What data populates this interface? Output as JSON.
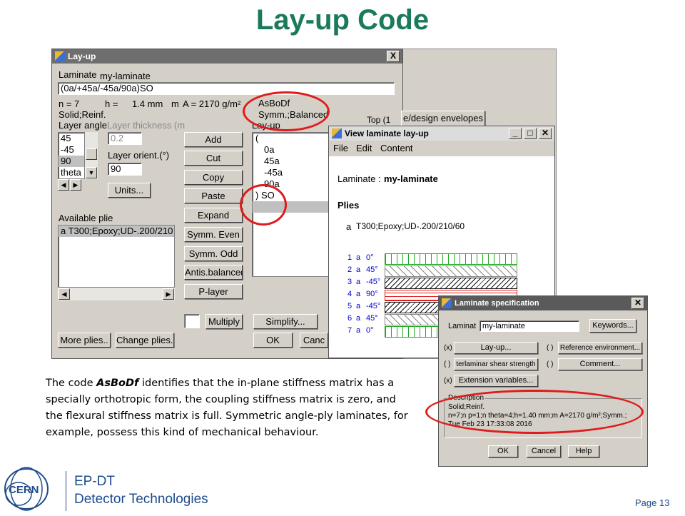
{
  "slide": {
    "title": "Lay-up Code",
    "description_parts": [
      "The code ",
      "AsBoDf",
      " identifies that the in-plane stiffness matrix has a specially orthotropic form, the coupling stiffness matrix is zero, and the flexural stiffness matrix is full. Symmetric angle-ply laminates, for example, possess this kind of mechanical behaviour."
    ],
    "page_number": "Page 13",
    "logo_text": "CERN",
    "org_line1": "EP-DT",
    "org_line2": "Detector Technologies"
  },
  "layup_window": {
    "title": "Lay-up",
    "close": "X",
    "laminate_label": "Laminate",
    "laminate_name": "my-laminate",
    "code_value": "(0a/+45a/-45a/90a)SO",
    "n_text": "n = 7",
    "h_text": "h =",
    "h_value": "1.4 mm",
    "m_text": "m",
    "a_text": "A = 2170 g/m²",
    "solid_text": "Solid;Reinf.",
    "asbodf": "AsBoDf",
    "symm_balanced": "Symm.;Balanced",
    "layer_angle_label": "Layer angle",
    "layer_thickness_label": "Layer thickness (m",
    "angle_list": [
      "45",
      "-45",
      "90",
      "theta"
    ],
    "thickness_value": "0.2",
    "layer_orient_label": "Layer orient.(°)",
    "orient_value": "90",
    "units_button": "Units...",
    "available_plies_label": "Available plie",
    "available_plies": [
      "a T300;Epoxy;UD-.200/210"
    ],
    "layup_list_label": "Lay-up",
    "layup_list": [
      "(",
      "0a",
      "45a",
      "-45a",
      "90a",
      ") SO"
    ],
    "buttons": {
      "add": "Add",
      "cut": "Cut",
      "copy": "Copy",
      "paste": "Paste",
      "expand": "Expand",
      "symm_even": "Symm. Even",
      "symm_odd": "Symm. Odd",
      "antis_balanced": "Antis.balanced",
      "p_layer": "P-layer",
      "multiply": "Multiply",
      "simplify": "Simplify...",
      "ok": "OK",
      "cancel": "Canc",
      "more_plies": "More plies..",
      "change_plies": "Change plies.."
    },
    "behind_tab": "e/design envelopes",
    "behind_top": "Top (1"
  },
  "view_window": {
    "title": "View laminate lay-up",
    "menu": [
      "File",
      "Edit",
      "Content"
    ],
    "laminate_label": "Laminate :",
    "laminate_name": "my-laminate",
    "plies_label": "Plies",
    "ply_key": "a",
    "ply_desc": "T300;Epoxy;UD-.200/210/60",
    "stack": [
      {
        "num": "1",
        "ply": "a",
        "angle": "0°",
        "pattern": "v"
      },
      {
        "num": "2",
        "ply": "a",
        "angle": "45°",
        "pattern": "d45"
      },
      {
        "num": "3",
        "ply": "a",
        "angle": "-45°",
        "pattern": "d-45"
      },
      {
        "num": "4",
        "ply": "a",
        "angle": "90°",
        "pattern": "h"
      },
      {
        "num": "5",
        "ply": "a",
        "angle": "-45°",
        "pattern": "d-45"
      },
      {
        "num": "6",
        "ply": "a",
        "angle": "45°",
        "pattern": "d45"
      },
      {
        "num": "7",
        "ply": "a",
        "angle": "0°",
        "pattern": "v"
      }
    ],
    "colors": {
      "v": "#22aa22",
      "d45": "#888888",
      "d-45": "#111111",
      "h": "#e02020"
    }
  },
  "spec_window": {
    "title": "Laminate specification",
    "laminat_label": "Laminat",
    "laminat_value": "my-laminate",
    "keywords_button": "Keywords...",
    "rows": [
      {
        "flag": "(x)",
        "label": "Lay-up...",
        "flag2": "( )",
        "label2": "Reference environment..."
      },
      {
        "flag": "( )",
        "label": "terlaminar shear strength",
        "flag2": "( )",
        "label2": "Comment..."
      },
      {
        "flag": "(x)",
        "label": "Extension variables...",
        "flag2": "",
        "label2": ""
      }
    ],
    "description_label": "Description",
    "description_lines": [
      "Solid;Reinf.",
      "n=7;n  p=1;n  theta=4;h=1.40 mm;m  A=2170 g/m²;Symm.;",
      "Tue Feb 23 17:33:08 2016"
    ],
    "ok": "OK",
    "cancel": "Cancel",
    "help": "Help"
  }
}
